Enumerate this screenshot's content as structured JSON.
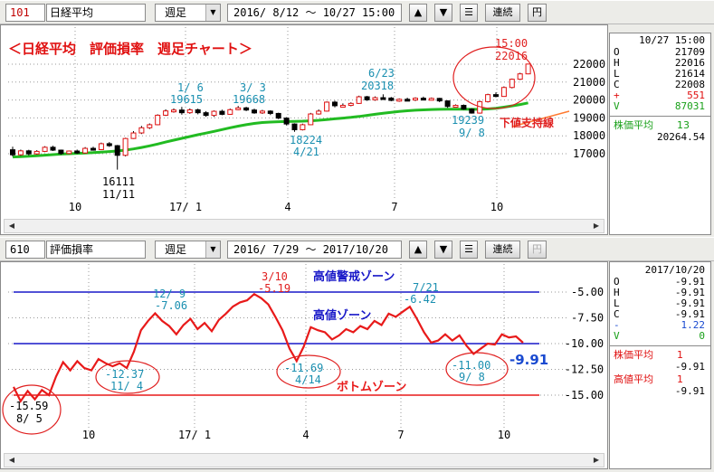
{
  "top_toolbar": {
    "code": "101",
    "name": "日経平均",
    "period": "週足",
    "range": "2016/ 8/12 ～ 10/27 15:00",
    "continuous_label": "連続",
    "yen_label": "円"
  },
  "top_chart": {
    "title": "＜日経平均　評価損率　週足チャート＞",
    "y_ticks": [
      "22000",
      "21000",
      "20000",
      "19000",
      "18000",
      "17000"
    ],
    "x_ticks": [
      "10",
      "17/ 1",
      "4",
      "7",
      "10"
    ],
    "annotations": {
      "low1": "16111",
      "low1_date": "11/11",
      "peak1_date": "1/ 6",
      "peak1": "19615",
      "peak2_date": "3/ 3",
      "peak2": "19668",
      "low2": "18224",
      "low2_date": "4/21",
      "peak3_date": "6/23",
      "peak3": "20318",
      "low3": "19239",
      "low3_date": "9/ 8",
      "latest_time": "15:00",
      "latest_value": "22016",
      "support_line": "下値支持線"
    },
    "ma_color": "#22bb22",
    "candles": [
      [
        17220,
        16940,
        17390,
        16850
      ],
      [
        16940,
        17160,
        17230,
        16880
      ],
      [
        17160,
        16990,
        17220,
        16900
      ],
      [
        16990,
        17130,
        17200,
        16950
      ],
      [
        17130,
        17360,
        17420,
        17090
      ],
      [
        17360,
        17200,
        17440,
        17150
      ],
      [
        17200,
        17010,
        17230,
        16940
      ],
      [
        17010,
        17150,
        17180,
        16980
      ],
      [
        17150,
        17040,
        17230,
        16990
      ],
      [
        17040,
        17300,
        17370,
        17010
      ],
      [
        17300,
        17230,
        17390,
        17170
      ],
      [
        17230,
        17560,
        17620,
        17200
      ],
      [
        17560,
        17450,
        17650,
        17380
      ],
      [
        17450,
        16910,
        17490,
        16111
      ],
      [
        16910,
        17850,
        17890,
        16850
      ],
      [
        17850,
        18160,
        18260,
        17830
      ],
      [
        18160,
        18450,
        18550,
        18100
      ],
      [
        18450,
        18620,
        18690,
        18380
      ],
      [
        18620,
        19150,
        19200,
        18590
      ],
      [
        19150,
        19390,
        19480,
        19110
      ],
      [
        19390,
        19440,
        19530,
        19290
      ],
      [
        19440,
        19290,
        19615,
        19180
      ],
      [
        19290,
        19450,
        19530,
        19230
      ],
      [
        19450,
        19290,
        19520,
        19200
      ],
      [
        19290,
        19140,
        19380,
        19060
      ],
      [
        19140,
        19370,
        19420,
        19060
      ],
      [
        19370,
        19200,
        19460,
        19150
      ],
      [
        19200,
        19460,
        19520,
        19180
      ],
      [
        19460,
        19560,
        19668,
        19430
      ],
      [
        19560,
        19440,
        19620,
        19380
      ],
      [
        19440,
        19280,
        19520,
        19230
      ],
      [
        19280,
        19380,
        19450,
        19220
      ],
      [
        19380,
        19250,
        19430,
        19160
      ],
      [
        19250,
        18990,
        19290,
        18930
      ],
      [
        18990,
        18660,
        19040,
        18580
      ],
      [
        18660,
        18340,
        18700,
        18224
      ],
      [
        18340,
        18620,
        18680,
        18300
      ],
      [
        18620,
        19220,
        19280,
        18600
      ],
      [
        19220,
        19380,
        19470,
        19180
      ],
      [
        19380,
        19880,
        19920,
        19350
      ],
      [
        19880,
        19680,
        19960,
        19590
      ],
      [
        19680,
        19700,
        19810,
        19620
      ],
      [
        19700,
        19810,
        19870,
        19650
      ],
      [
        19810,
        20180,
        20240,
        19780
      ],
      [
        20180,
        20010,
        20230,
        19950
      ],
      [
        20010,
        20130,
        20200,
        19960
      ],
      [
        20130,
        20110,
        20318,
        20040
      ],
      [
        20110,
        19980,
        20170,
        19930
      ],
      [
        19980,
        20040,
        20090,
        19900
      ],
      [
        20040,
        20000,
        20130,
        19960
      ],
      [
        20000,
        20100,
        20150,
        19940
      ],
      [
        20100,
        20030,
        20190,
        19990
      ],
      [
        20030,
        20090,
        20140,
        20000
      ],
      [
        20090,
        19950,
        20120,
        19880
      ],
      [
        19950,
        19640,
        19980,
        19560
      ],
      [
        19640,
        19700,
        19750,
        19600
      ],
      [
        19700,
        19490,
        19750,
        19450
      ],
      [
        19490,
        19270,
        19540,
        19239
      ],
      [
        19270,
        19910,
        19960,
        19240
      ],
      [
        19910,
        20300,
        20350,
        19860
      ],
      [
        20300,
        20200,
        20420,
        20150
      ],
      [
        20200,
        20700,
        20760,
        20180
      ],
      [
        20700,
        21160,
        21200,
        20650
      ],
      [
        21160,
        21460,
        21520,
        21120
      ],
      [
        21460,
        22008,
        22016,
        21440
      ]
    ],
    "ma": [
      16820,
      16840,
      16860,
      16890,
      16920,
      16950,
      16980,
      17000,
      17020,
      17040,
      17060,
      17090,
      17120,
      17150,
      17200,
      17270,
      17350,
      17440,
      17540,
      17650,
      17760,
      17860,
      17960,
      18060,
      18150,
      18250,
      18350,
      18450,
      18540,
      18620,
      18690,
      18740,
      18770,
      18790,
      18800,
      18810,
      18820,
      18840,
      18870,
      18910,
      18950,
      18990,
      19030,
      19080,
      19140,
      19200,
      19260,
      19310,
      19360,
      19400,
      19430,
      19450,
      19470,
      19480,
      19490,
      19490,
      19490,
      19480,
      19480,
      19500,
      19540,
      19600,
      19670,
      19750,
      19840
    ]
  },
  "top_side": {
    "header": "10/27 15:00",
    "rows": [
      {
        "k": "O",
        "v": "21709"
      },
      {
        "k": "H",
        "v": "22016"
      },
      {
        "k": "L",
        "v": "21614"
      },
      {
        "k": "C",
        "v": "22008"
      },
      {
        "k": "+",
        "v": "551"
      },
      {
        "k": "V",
        "v": "87031"
      }
    ],
    "ma_label": "株価平均",
    "ma_period": "13",
    "ma_value": "20264.54"
  },
  "bottom_toolbar": {
    "code": "610",
    "name": "評価損率",
    "period": "週足",
    "range": "2016/ 7/29 ～  2017/10/20",
    "continuous_label": "連続",
    "yen_label": "円"
  },
  "bottom_chart": {
    "y_ticks": [
      "-5.00",
      "-7.50",
      "-10.00",
      "-12.50",
      "-15.00"
    ],
    "x_ticks": [
      "10",
      "17/ 1",
      "4",
      "7",
      "10"
    ],
    "zone_high_warn": "高値警戒ゾーン",
    "zone_high": "高値ゾーン",
    "zone_bottom": "ボトムゾーン",
    "current_value": "-9.91",
    "annotations": {
      "low1": "-15.59",
      "low1_date": "8/ 5",
      "low2": "-12.37",
      "low2_date": "11/ 4",
      "peak1_date": "12/ 9",
      "peak1": "-7.06",
      "peak2_date": "3/10",
      "peak2": "-5.19",
      "low3": "-11.69",
      "low3_date": "4/14",
      "peak3_date": "7/21",
      "peak3": "-6.42",
      "low4": "-11.00",
      "low4_date": "9/ 8"
    },
    "series": [
      -14.2,
      -15.59,
      -14.6,
      -15.4,
      -14.5,
      -15.0,
      -13.2,
      -11.8,
      -12.6,
      -11.7,
      -12.37,
      -12.6,
      -11.5,
      -11.9,
      -12.2,
      -11.9,
      -12.37,
      -10.8,
      -8.7,
      -7.8,
      -7.06,
      -7.8,
      -8.3,
      -9.1,
      -8.2,
      -7.6,
      -8.6,
      -8.0,
      -8.8,
      -7.7,
      -7.1,
      -6.4,
      -6.0,
      -5.8,
      -5.19,
      -5.6,
      -6.2,
      -7.4,
      -8.7,
      -10.5,
      -11.69,
      -10.3,
      -8.4,
      -8.7,
      -8.9,
      -9.6,
      -9.2,
      -8.6,
      -8.9,
      -8.3,
      -8.6,
      -7.8,
      -8.2,
      -7.1,
      -7.4,
      -6.9,
      -6.42,
      -7.6,
      -8.9,
      -9.9,
      -9.7,
      -9.1,
      -9.7,
      -9.2,
      -10.2,
      -11.0,
      -10.5,
      -10.0,
      -10.1,
      -9.1,
      -9.4,
      -9.3,
      -9.91
    ]
  },
  "bottom_side": {
    "header": "2017/10/20",
    "rows": [
      {
        "k": "O",
        "v": "-9.91"
      },
      {
        "k": "H",
        "v": "-9.91"
      },
      {
        "k": "L",
        "v": "-9.91"
      },
      {
        "k": "C",
        "v": "-9.91"
      },
      {
        "k": "-",
        "v": "1.22"
      },
      {
        "k": "V",
        "v": "0"
      }
    ],
    "avg1_label": "株価平均",
    "avg1_period": "1",
    "avg1_value": "-9.91",
    "avg2_label": "高値平均",
    "avg2_period": "1",
    "avg2_value": "-9.91"
  }
}
